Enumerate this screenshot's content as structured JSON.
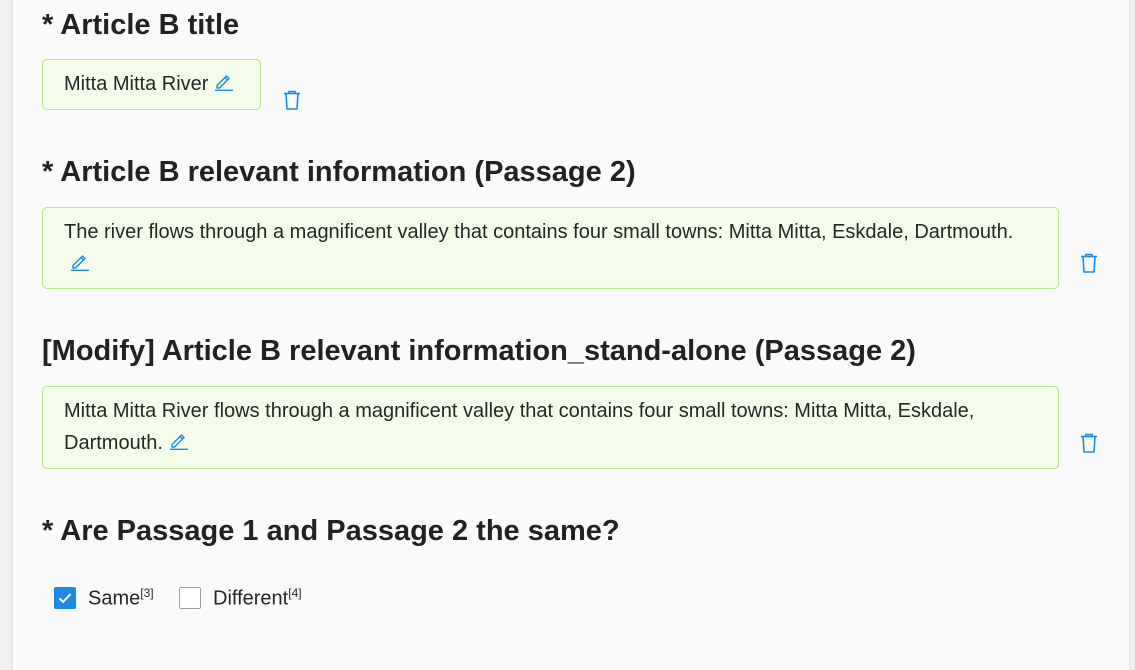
{
  "sections": [
    {
      "heading": "* Article B title",
      "value": "Mitta Mitta River"
    },
    {
      "heading": "* Article B relevant information (Passage 2)",
      "value": "The river flows through a magnificent valley that contains four small towns: Mitta Mitta, Eskdale, Dartmouth."
    },
    {
      "heading": "[Modify] Article B relevant information_stand-alone (Passage 2)",
      "value": "Mitta Mitta River flows through a magnificent valley that contains four small towns: Mitta Mitta, Eskdale, Dartmouth."
    },
    {
      "heading": "* Are Passage 1 and Passage 2 the same?"
    }
  ],
  "options": [
    {
      "label": "Same",
      "sup": "[3]",
      "checked": true
    },
    {
      "label": "Different",
      "sup": "[4]",
      "checked": false
    }
  ],
  "colors": {
    "accent": "#1e88e5",
    "box_bg": "#f3fde9",
    "box_border": "#b6e58a"
  },
  "icons": {
    "edit": "pencil-icon",
    "delete": "trash-icon",
    "check": "check-icon"
  }
}
